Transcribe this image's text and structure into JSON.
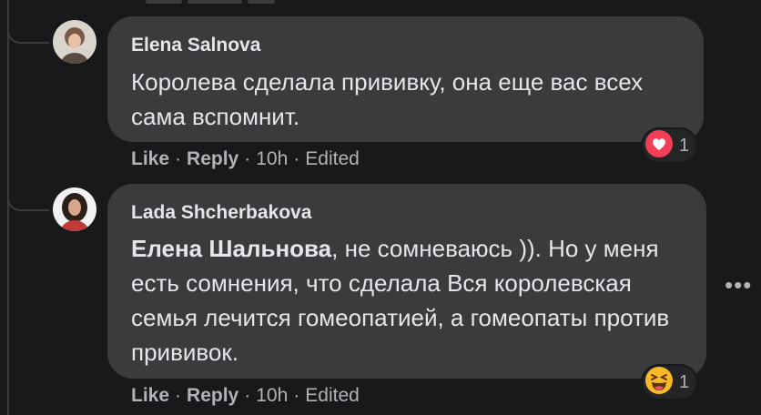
{
  "comments": [
    {
      "author": "Elena Salnova",
      "text": "Королева сделала прививку, она еще вас всех сама вспомнит.",
      "actions": {
        "like": "Like",
        "reply": "Reply",
        "time": "10h",
        "edited": "Edited"
      },
      "reaction": {
        "icon": "love-reaction-icon",
        "count": "1",
        "color": "#f33e58"
      }
    },
    {
      "author": "Lada Shcherbakova",
      "mention": "Елена Шальнова",
      "text": ", не сомневаюсь )). Но у меня есть сомнения, что сделала Вся королевская семья лечится гомеопатией, а гомеопаты против прививок.",
      "actions": {
        "like": "Like",
        "reply": "Reply",
        "time": "10h",
        "edited": "Edited"
      },
      "reaction": {
        "icon": "haha-reaction-icon",
        "count": "1",
        "color": "#f7b928"
      }
    }
  ],
  "more_options": "•••",
  "dot_separator": "·"
}
